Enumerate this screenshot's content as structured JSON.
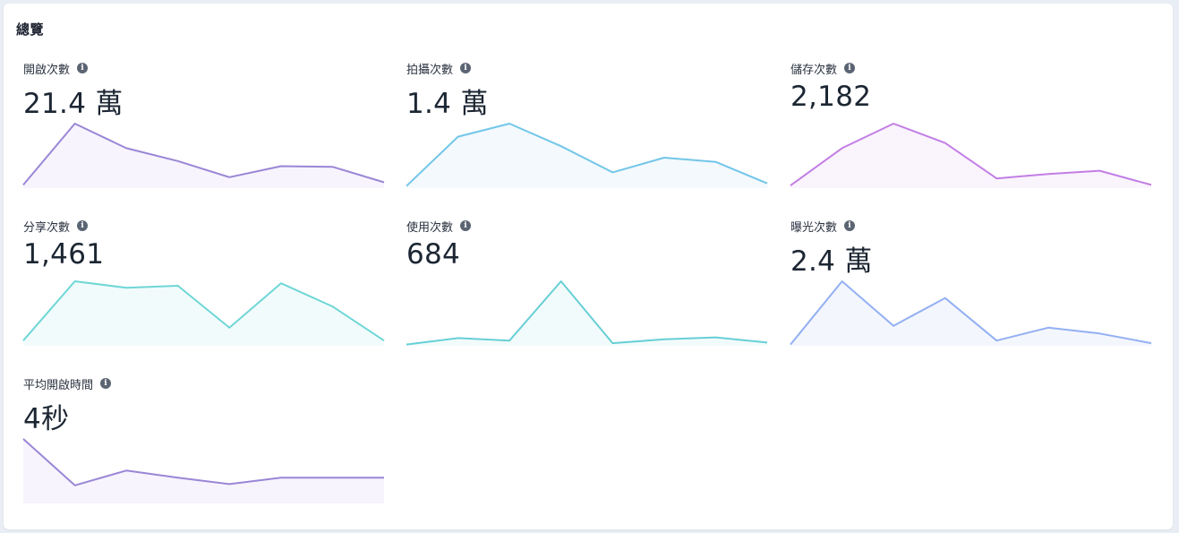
{
  "panel": {
    "title": "總覽"
  },
  "info_icon": "info-icon",
  "cards": [
    {
      "label": "開啟次數",
      "value": "21.4 萬",
      "color": "#9a86d6",
      "fill": "#f7f4fd",
      "trend": [
        5,
        100,
        62,
        42,
        17,
        34,
        33,
        9
      ]
    },
    {
      "label": "拍攝次數",
      "value": "1.4 萬",
      "color": "#72c6e8",
      "fill": "#f3f9fd",
      "trend": [
        4,
        98,
        123,
        80,
        30,
        58,
        50,
        9
      ]
    },
    {
      "label": "儲存次數",
      "value": "2,182",
      "color": "#c27ee4",
      "fill": "#faf4fd",
      "trend": [
        4,
        62,
        100,
        70,
        15,
        22,
        27,
        5
      ]
    },
    {
      "label": "分享次數",
      "value": "1,461",
      "color": "#6fd6d6",
      "fill": "#f1fbfb",
      "trend": [
        8,
        100,
        90,
        93,
        28,
        97,
        61,
        8
      ]
    },
    {
      "label": "使用次數",
      "value": "684",
      "color": "#68cfd6",
      "fill": "#f2fbfb",
      "trend": [
        2,
        12,
        8,
        100,
        4,
        10,
        13,
        5
      ]
    },
    {
      "label": "曝光次數",
      "value": "2.4 萬",
      "color": "#93b0f2",
      "fill": "#f4f6fe",
      "trend": [
        2,
        100,
        31,
        74,
        8,
        28,
        19,
        4
      ]
    },
    {
      "label": "平均開啟時間",
      "value": "4秒",
      "color": "#9a86d6",
      "fill": "#f7f4fd",
      "trend": [
        100,
        28,
        51,
        40,
        30,
        40,
        40,
        40
      ]
    }
  ]
}
